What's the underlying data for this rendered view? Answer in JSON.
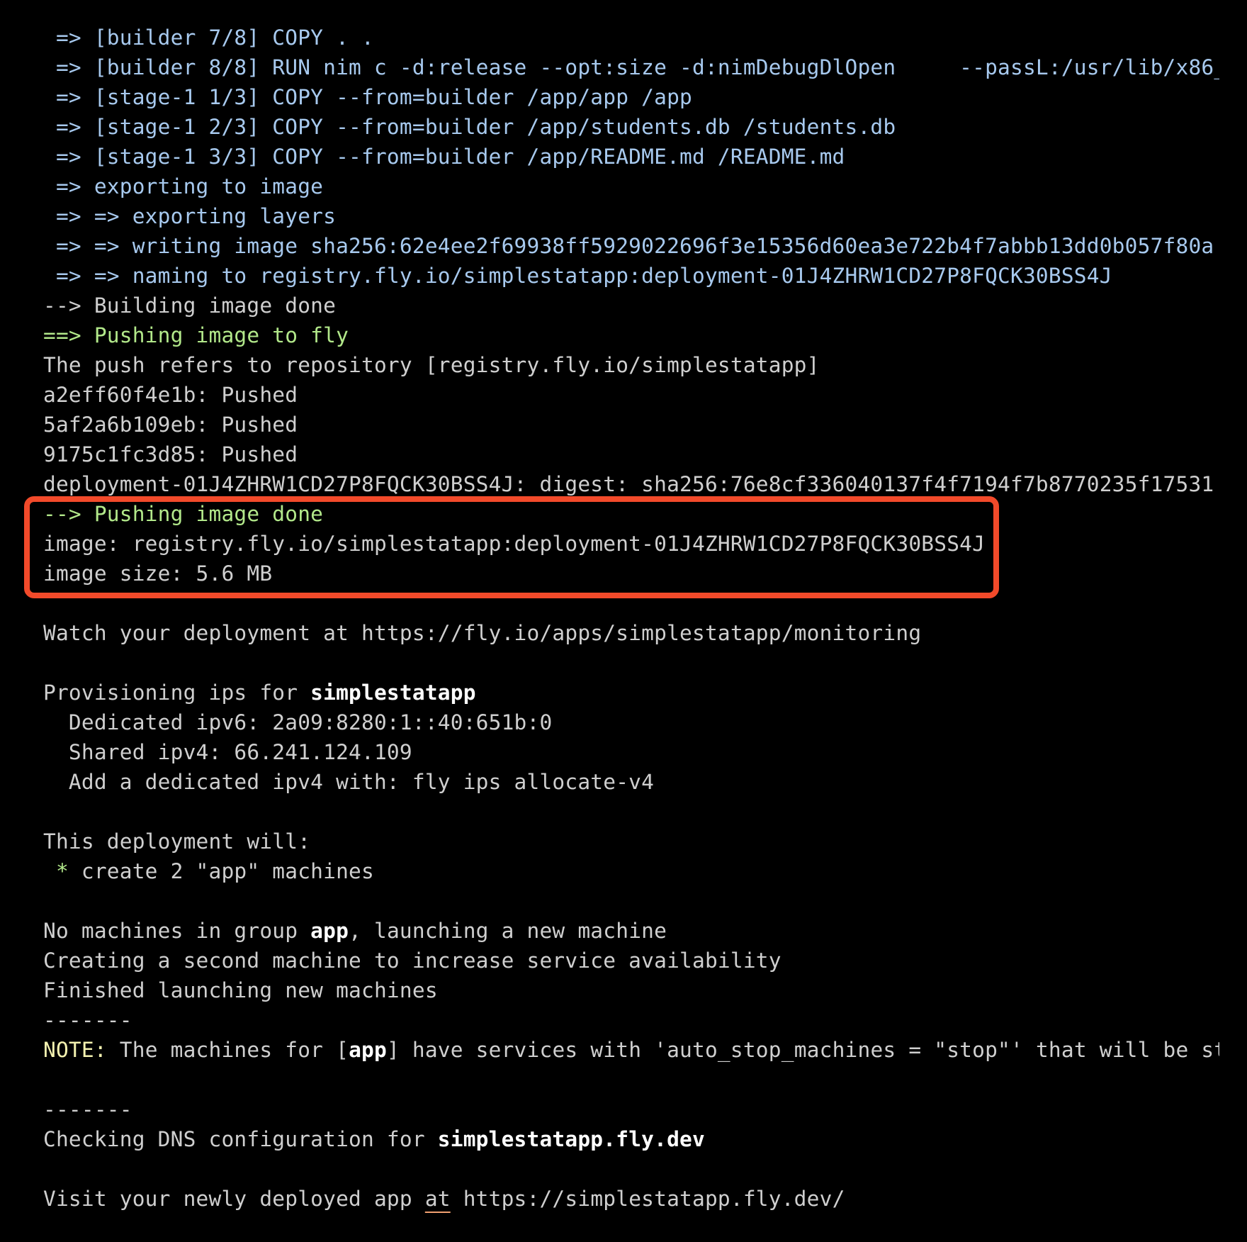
{
  "terminal": {
    "colors": {
      "background": "#000000",
      "text": "#cfcfcf",
      "build_step": "#a7c9ee",
      "success": "#b2e88a",
      "note": "#f4f2b0",
      "highlight_box": "#f24a2a"
    },
    "build_steps": [
      " => [builder 7/8] COPY . .",
      " => [builder 8/8] RUN nim c -d:release --opt:size -d:nimDebugDlOpen     --passL:/usr/lib/x86_",
      " => [stage-1 1/3] COPY --from=builder /app/app /app",
      " => [stage-1 2/3] COPY --from=builder /app/students.db /students.db",
      " => [stage-1 3/3] COPY --from=builder /app/README.md /README.md",
      " => exporting to image",
      " => => exporting layers",
      " => => writing image sha256:62e4ee2f69938ff5929022696f3e15356d60ea3e722b4f7abbb13dd0b057f80a",
      " => => naming to registry.fly.io/simplestatapp:deployment-01J4ZHRW1CD27P8FQCK30BSS4J"
    ],
    "building_done": "--> Building image done",
    "pushing_header": "==> Pushing image to fly",
    "push_repo": "The push refers to repository [registry.fly.io/simplestatapp]",
    "layers": [
      "a2eff60f4e1b: Pushed",
      "5af2a6b109eb: Pushed",
      "9175c1fc3d85: Pushed"
    ],
    "digest_line": "deployment-01J4ZHRW1CD27P8FQCK30BSS4J: digest: sha256:76e8cf336040137f4f7194f7b8770235f17531",
    "highlighted": {
      "pushing_done": "--> Pushing image done",
      "image": "image: registry.fly.io/simplestatapp:deployment-01J4ZHRW1CD27P8FQCK30BSS4J",
      "image_size": "image size: 5.6 MB"
    },
    "watch_line": "Watch your deployment at https://fly.io/apps/simplestatapp/monitoring",
    "provisioning": {
      "prefix": "Provisioning ips for ",
      "app": "simplestatapp",
      "ipv6": "  Dedicated ipv6: 2a09:8280:1::40:651b:0",
      "ipv4": "  Shared ipv4: 66.241.124.109",
      "allocate_hint": "  Add a dedicated ipv4 with: fly ips allocate-v4"
    },
    "plan": {
      "header": "This deployment will:",
      "bullet": " *",
      "item": " create 2 \"app\" machines"
    },
    "machines": {
      "no_machines_prefix": "No machines in group ",
      "group": "app",
      "no_machines_suffix": ", launching a new machine",
      "second": "Creating a second machine to increase service availability",
      "finished": "Finished launching new machines"
    },
    "separator": "-------",
    "note": {
      "label": "NOTE:",
      "prefix": " The machines for [",
      "group": "app",
      "suffix": "] have services with 'auto_stop_machines = \"stop\"' that will be st"
    },
    "dns": {
      "prefix": "Checking DNS configuration for ",
      "host": "simplestatapp.fly.dev"
    },
    "visit": {
      "prefix": "Visit your newly deployed app ",
      "at": "at",
      "url": " https://simplestatapp.fly.dev/"
    }
  }
}
